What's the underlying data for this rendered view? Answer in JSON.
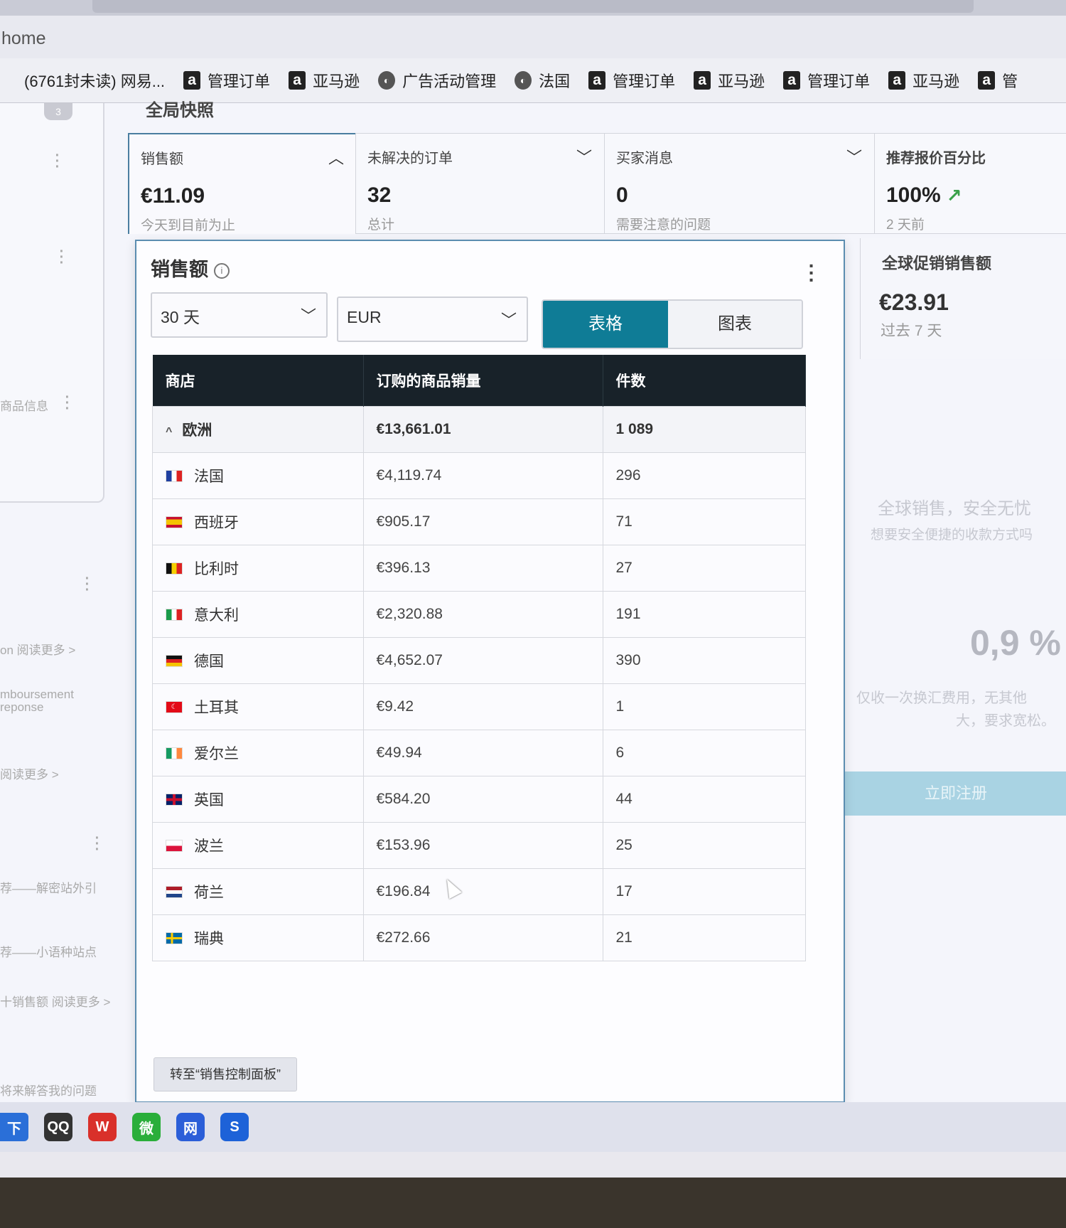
{
  "browser": {
    "address_text": "home",
    "bookmarks": [
      {
        "icon": "plain-icon",
        "label": "(6761封未读) 网易..."
      },
      {
        "icon": "amazon-icon",
        "label": "管理订单"
      },
      {
        "icon": "amazon-icon",
        "label": "亚马逊"
      },
      {
        "icon": "globe-icon",
        "label": "广告活动管理"
      },
      {
        "icon": "globe-icon",
        "label": "法国"
      },
      {
        "icon": "amazon-icon",
        "label": "管理订单"
      },
      {
        "icon": "amazon-icon",
        "label": "亚马逊"
      },
      {
        "icon": "amazon-icon",
        "label": "管理订单"
      },
      {
        "icon": "amazon-icon",
        "label": "亚马逊"
      },
      {
        "icon": "amazon-icon",
        "label": "管"
      }
    ]
  },
  "section_title": "全局快照",
  "left_panel": {
    "badge": "3",
    "items": [
      "商品信息",
      "on 阅读更多 >",
      "mboursement",
      "reponse",
      "阅读更多 >",
      "荐——解密站外引",
      "荐——小语种站点",
      "十销售额 阅读更多 >",
      "将来解答我的问题"
    ]
  },
  "kpis": [
    {
      "label": "销售额",
      "value": "€11.09",
      "sub": "今天到目前为止"
    },
    {
      "label": "未解决的订单",
      "value": "32",
      "sub": "总计"
    },
    {
      "label": "买家消息",
      "value": "0",
      "sub": "需要注意的问题"
    },
    {
      "label": "推荐报价百分比",
      "value": "100%",
      "sub": "2 天前"
    }
  ],
  "global_promo_sales": {
    "label": "全球促销销售额",
    "value": "€23.91",
    "sub": "过去 7 天"
  },
  "promo": {
    "line1": "全球销售，安全无忧",
    "line2": "想要安全便捷的收款方式吗",
    "rate": "0,9 %",
    "line3": "仅收一次换汇费用，无其他",
    "line4": "大，要求宽松。",
    "button": "立即注册"
  },
  "sales_panel": {
    "title": "销售额",
    "period": "30 天",
    "currency": "EUR",
    "view_table": "表格",
    "view_chart": "图表",
    "columns": [
      "商店",
      "订购的商品销量",
      "件数"
    ],
    "group": {
      "name": "欧洲",
      "sales": "€13,661.01",
      "units": "1 089"
    },
    "rows": [
      {
        "store": "法国",
        "sales": "€4,119.74",
        "units": "296"
      },
      {
        "store": "西班牙",
        "sales": "€905.17",
        "units": "71"
      },
      {
        "store": "比利时",
        "sales": "€396.13",
        "units": "27"
      },
      {
        "store": "意大利",
        "sales": "€2,320.88",
        "units": "191"
      },
      {
        "store": "德国",
        "sales": "€4,652.07",
        "units": "390"
      },
      {
        "store": "土耳其",
        "sales": "€9.42",
        "units": "1"
      },
      {
        "store": "爱尔兰",
        "sales": "€49.94",
        "units": "6"
      },
      {
        "store": "英国",
        "sales": "€584.20",
        "units": "44"
      },
      {
        "store": "波兰",
        "sales": "€153.96",
        "units": "25"
      },
      {
        "store": "荷兰",
        "sales": "€196.84",
        "units": "17"
      },
      {
        "store": "瑞典",
        "sales": "€272.66",
        "units": "21"
      }
    ],
    "footer_button": "转至“销售控制面板”"
  },
  "taskbar": [
    "下",
    "QQ",
    "W",
    "微",
    "网",
    "S"
  ]
}
